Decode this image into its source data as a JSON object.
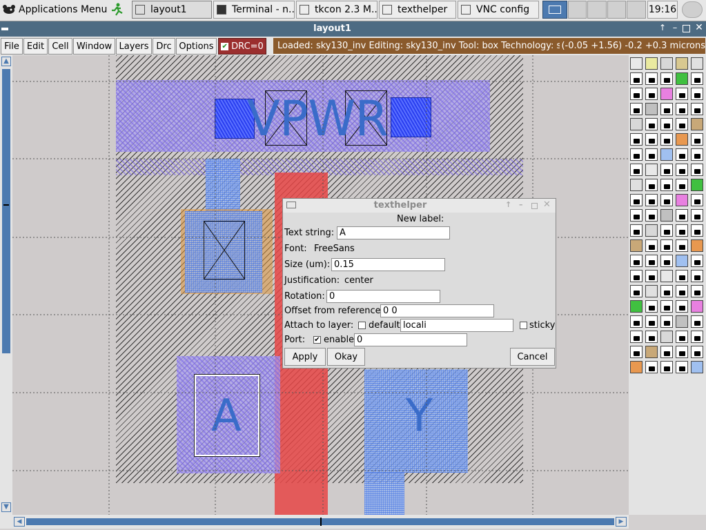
{
  "taskbar": {
    "app_menu": "Applications Menu",
    "windows": [
      "layout1",
      "Terminal - n...",
      "tkcon 2.3 M...",
      "texthelper",
      "VNC config"
    ],
    "clock": "19:16"
  },
  "window": {
    "title": "layout1",
    "menus": [
      "File",
      "Edit",
      "Cell",
      "Window",
      "Layers",
      "Drc",
      "Options"
    ],
    "drc_label": "DRC=0",
    "status": "Loaded: sky130_inv Editing: sky130_inv Tool: box  Technology: sk",
    "coords": "(-0.05 +1.56) -0.2 +0.3 microns"
  },
  "layout": {
    "label_vpwr": "VPWR",
    "label_a": "A",
    "label_y": "Y"
  },
  "dialog": {
    "title": "texthelper",
    "heading": "New label:",
    "text_string_label": "Text string:",
    "text_string_value": "A",
    "font_label": "Font:",
    "font_value": "FreeSans",
    "size_label": "Size (um):",
    "size_value": "0.15",
    "justification_label": "Justification:",
    "justification_value": "center",
    "rotation_label": "Rotation:",
    "rotation_value": "0",
    "offset_label": "Offset from reference:",
    "offset_value": "0 0",
    "attach_label": "Attach to layer:",
    "default_label": "default",
    "attach_value": "locali",
    "sticky_label": "sticky",
    "port_label": "Port:",
    "enable_label": "enable",
    "port_value": "0",
    "apply": "Apply",
    "okay": "Okay",
    "cancel": "Cancel"
  }
}
